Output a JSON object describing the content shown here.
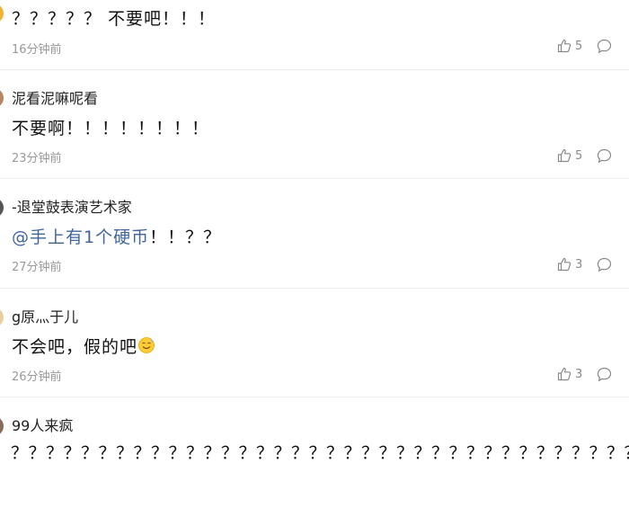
{
  "comments": [
    {
      "username": "",
      "text": "？？？？？ 不要吧！！！",
      "time": "16分钟前",
      "likes": "5"
    },
    {
      "username": "泥看泥嘛呢看",
      "text": "不要啊！！！！！！！！",
      "time": "23分钟前",
      "likes": "5"
    },
    {
      "username": "-退堂鼓表演艺术家",
      "mention": "@手上有1个硬币",
      "text": "！！？？",
      "time": "27分钟前",
      "likes": "3"
    },
    {
      "username": "g原灬于儿",
      "text": "不会吧，假的吧",
      "emoji": "smiling-sweat-emoji",
      "time": "26分钟前",
      "likes": "3"
    },
    {
      "username": "99人来疯",
      "text": "？？？？？？？？？？？？？？？？？？？？？？？？？？？？？？？？？？？？？？？？？？？？？？？？？？？？？？？？？？？？？？？？？？？？？？？？？？？？？？？？？？？？？？？？？？？？？？？？？？？？？？？？？？？"
    }
  ],
  "icons": {
    "like": "thumbs-up-icon",
    "reply": "comment-bubble-icon"
  },
  "colors": {
    "mention": "#406599",
    "meta": "#999999",
    "divider": "#eeeeee"
  }
}
